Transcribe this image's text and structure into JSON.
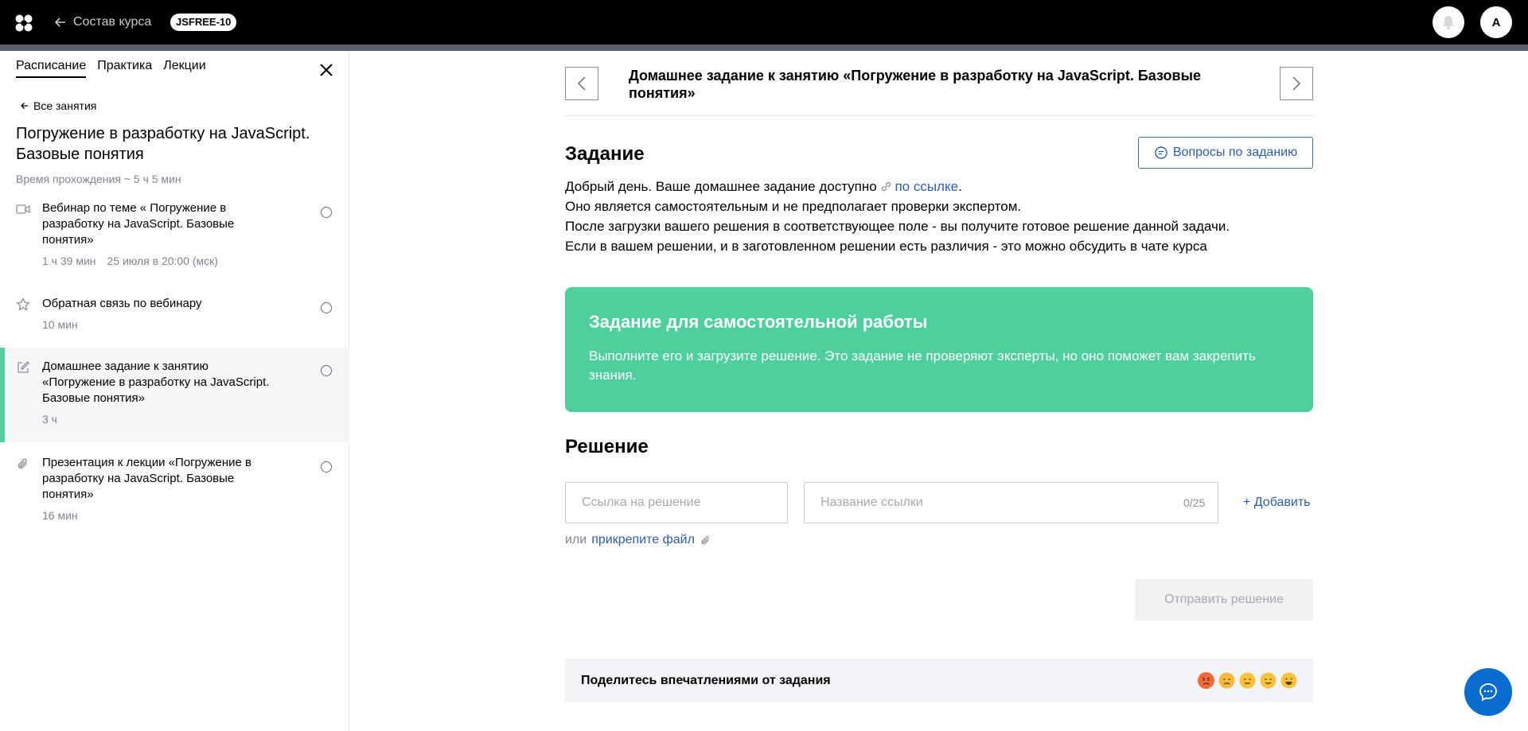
{
  "header": {
    "back_label": "Состав курса",
    "course_code": "JSFREE-10",
    "avatar_letter": "А"
  },
  "sidebar": {
    "tabs": [
      {
        "label": "Расписание",
        "active": true
      },
      {
        "label": "Практика",
        "active": false
      },
      {
        "label": "Лекции",
        "active": false
      }
    ],
    "all_lessons": "Все занятия",
    "lesson_title": "Погружение в разработку на JavaScript. Базовые понятия",
    "lesson_time": "Время прохождения ~ 5 ч 5 мин",
    "items": [
      {
        "icon": "video-icon",
        "title": "Вебинар по теме « Погружение в разработку на JavaScript. Базовые понятия»",
        "duration": "1 ч 39 мин",
        "date": "25 июля в 20:00 (мск)"
      },
      {
        "icon": "star-icon",
        "title": "Обратная связь по вебинару",
        "duration": "10 мин",
        "date": ""
      },
      {
        "icon": "edit-icon",
        "title": "Домашнее задание к занятию «Погружение в разработку на JavaScript. Базовые понятия»",
        "duration": "3 ч",
        "date": "",
        "active": true
      },
      {
        "icon": "paperclip-icon",
        "title": "Презентация к лекции «Погружение в разработку на JavaScript. Базовые понятия»",
        "duration": "16 мин",
        "date": ""
      }
    ]
  },
  "main": {
    "homework_title": "Домашнее задание к занятию «Погружение в разработку на JavaScript. Базовые понятия»",
    "task_heading": "Задание",
    "questions_button": "Вопросы по заданию",
    "task_text": {
      "line1_prefix": "Добрый день. Ваше домашнее задание доступно ",
      "line1_link": "по ссылке",
      "line1_suffix": ".",
      "line2": "Оно является самостоятельным и не предполагает проверки экспертом.",
      "line3": "После загрузки вашего решения в соответствующее поле - вы получите готовое решение данной задачи.",
      "line4": "Если в вашем решении, и в заготовленном решении есть различия - это можно обсудить в чате курса"
    },
    "card": {
      "title": "Задание для самостоятельной работы",
      "text": "Выполните его и загрузите решение. Это задание не проверяют эксперты, но оно поможет вам закрепить знания."
    },
    "solution_heading": "Решение",
    "link_input_placeholder": "Ссылка на решение",
    "name_input_placeholder": "Название ссылки",
    "name_counter": "0/25",
    "add_label": "+ Добавить",
    "attach_prefix": "или",
    "attach_link": "прикрепите файл",
    "submit_label": "Отправить решение",
    "feedback_text": "Поделитесь впечатлениями от задания",
    "feedback_emojis": [
      "angry-face-icon",
      "sad-face-icon",
      "neutral-face-icon",
      "slight-smile-icon",
      "big-smile-icon"
    ]
  },
  "colors": {
    "accent_green": "#4ecf9b",
    "link_blue": "#2d5ea8",
    "chat_blue": "#0a6ccf"
  }
}
